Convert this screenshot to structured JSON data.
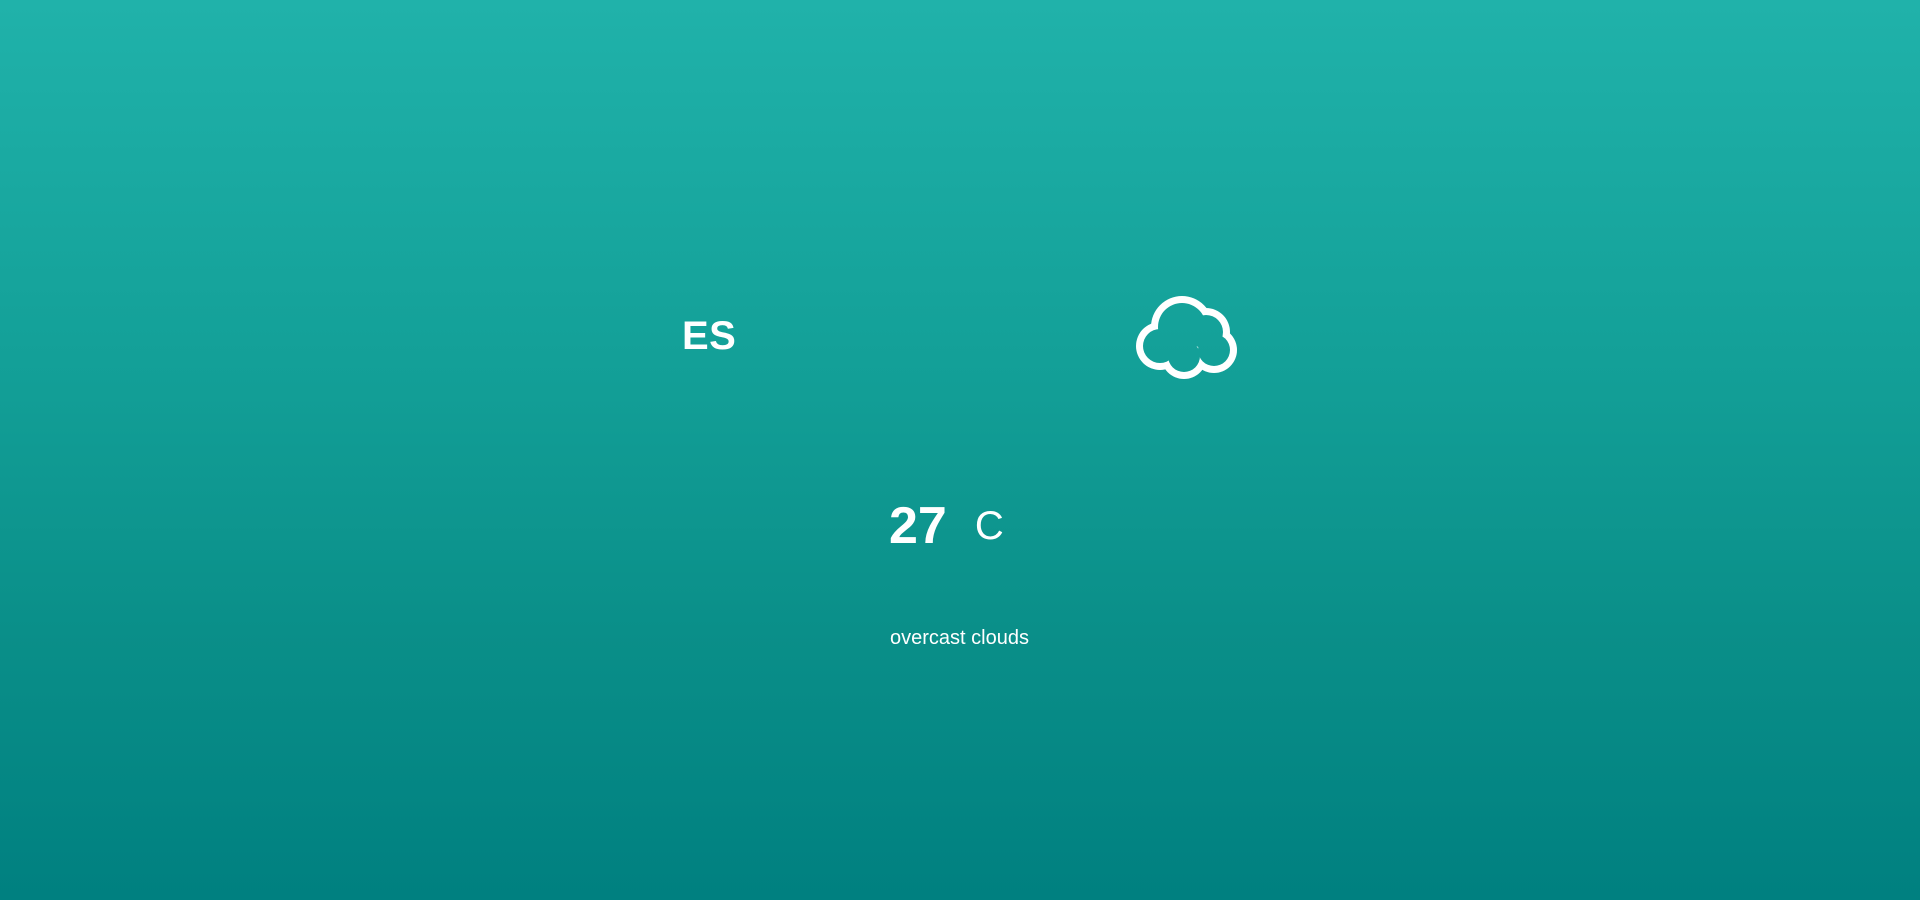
{
  "weather": {
    "country": "ES",
    "icon": "cloud-icon",
    "temperature": "27",
    "unit": "C",
    "description": "overcast clouds"
  },
  "colors": {
    "background_top": "#20b2aa",
    "background_bottom": "#008080",
    "text": "#ffffff"
  }
}
